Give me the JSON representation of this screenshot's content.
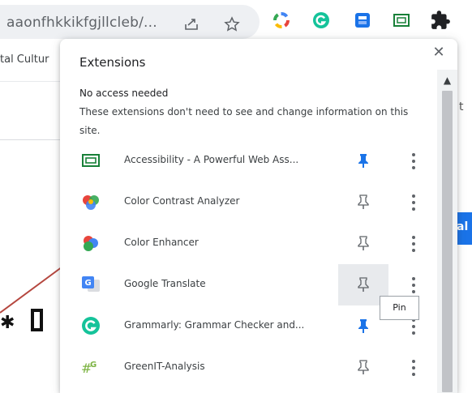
{
  "browser": {
    "url_fragment": "aaonfhkkikfgjllcleb/...",
    "bookmark_fragment": "tal Cultur",
    "toolbar_extensions": [
      "color-wheel-icon",
      "grammarly-icon",
      "save-icon",
      "accessibility-icon",
      "puzzle-icon"
    ]
  },
  "background": {
    "right_text": "t",
    "blue_button_fragment": "al"
  },
  "popup": {
    "title": "Extensions",
    "close_label": "✕",
    "section_heading": "No access needed",
    "section_description": "These extensions don't need to see and change information on this site.",
    "tooltip": "Pin",
    "extensions": [
      {
        "name": "Accessibility - A Powerful Web Ass...",
        "icon": "accessibility-icon",
        "pinned": true
      },
      {
        "name": "Color Contrast Analyzer",
        "icon": "color-contrast-icon",
        "pinned": false
      },
      {
        "name": "Color Enhancer",
        "icon": "color-enhancer-icon",
        "pinned": false
      },
      {
        "name": "Google Translate",
        "icon": "google-translate-icon",
        "pinned": false
      },
      {
        "name": "Grammarly: Grammar Checker and...",
        "icon": "grammarly-icon",
        "pinned": true
      },
      {
        "name": "GreenIT-Analysis",
        "icon": "greenit-icon",
        "pinned": false
      }
    ]
  },
  "colors": {
    "pin_active": "#1a73e8",
    "pin_inactive": "#5f6368",
    "grammarly_green": "#15c39a",
    "annotation_arrow": "#b5473f"
  }
}
